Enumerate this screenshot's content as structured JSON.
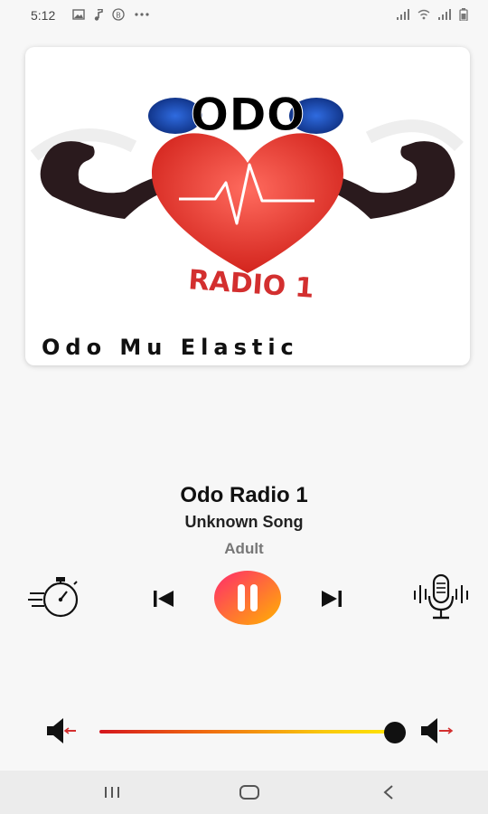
{
  "status_bar": {
    "time": "5:12",
    "left_icons": [
      "image-icon",
      "music-note-icon",
      "circle-b-icon",
      "more-dots-icon"
    ],
    "right_icons": [
      "signal-icon",
      "wifi-icon",
      "signal-icon",
      "battery-icon"
    ]
  },
  "album_art": {
    "logo_text": "ODO",
    "station_banner": "RADIO 1",
    "caption": "Odo Mu Elastic",
    "colors": {
      "heart": "#e53935",
      "logo_blue": "#1a3ea8",
      "arms": "#2a1a1d"
    }
  },
  "track": {
    "station": "Odo Radio 1",
    "song": "Unknown Song",
    "genre": "Adult"
  },
  "controls": {
    "timer": "timer-icon",
    "previous": "skip-previous-icon",
    "play_pause": "pause-icon",
    "next": "skip-next-icon",
    "voice": "microphone-icon",
    "accent_gradient": [
      "#ff2a6d",
      "#ffb300"
    ]
  },
  "volume": {
    "level": 0.99,
    "down_icon": "volume-down-icon",
    "up_icon": "volume-up-icon"
  },
  "nav_bar": {
    "recents": "recents-icon",
    "home": "home-icon",
    "back": "back-icon"
  }
}
